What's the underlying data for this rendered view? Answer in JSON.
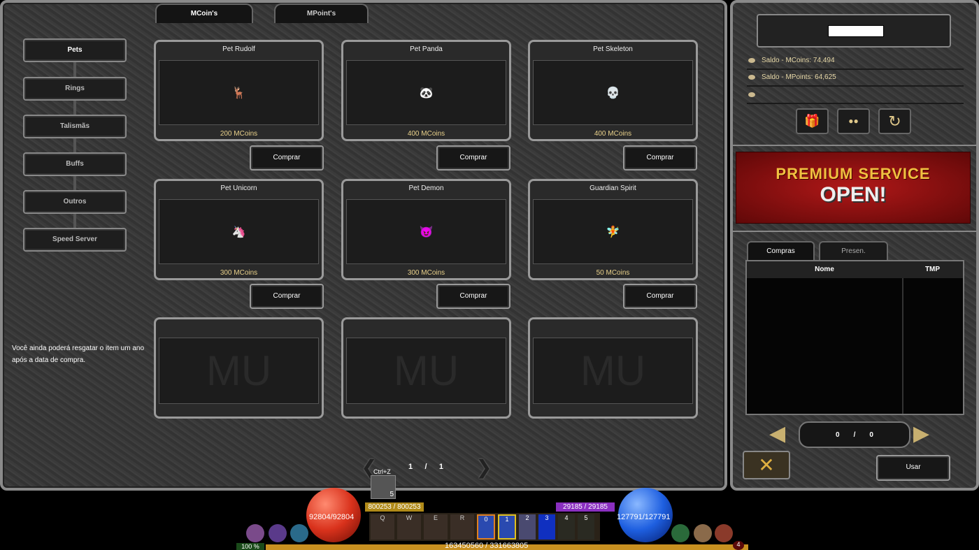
{
  "tabs": [
    {
      "label": "MCoin's",
      "active": true
    },
    {
      "label": "MPoint's",
      "active": false
    }
  ],
  "categories": [
    {
      "label": "Pets",
      "active": true
    },
    {
      "label": "Rings"
    },
    {
      "label": "Talismãs"
    },
    {
      "label": "Buffs"
    },
    {
      "label": "Outros"
    },
    {
      "label": "Speed Server"
    }
  ],
  "notice": "Você ainda poderá resgatar o item um ano após a data de compra.",
  "items": [
    {
      "name": "Pet Rudolf",
      "price": "200 MCoins",
      "buy": "Comprar",
      "icon": "🦌"
    },
    {
      "name": "Pet Panda",
      "price": "400 MCoins",
      "buy": "Comprar",
      "icon": "🐼"
    },
    {
      "name": "Pet Skeleton",
      "price": "400 MCoins",
      "buy": "Comprar",
      "icon": "💀"
    },
    {
      "name": "Pet Unicorn",
      "price": "300 MCoins",
      "buy": "Comprar",
      "icon": "🦄"
    },
    {
      "name": "Pet Demon",
      "price": "300 MCoins",
      "buy": "Comprar",
      "icon": "😈"
    },
    {
      "name": "Guardian Spirit",
      "price": "50 MCoins",
      "buy": "Comprar",
      "icon": "🧚"
    }
  ],
  "empty_slot_logo": "MU",
  "pager": {
    "current": "1",
    "sep": "/",
    "total": "1"
  },
  "account": {
    "saldo_mcoins": "Saldo - MCoins: 74,494",
    "saldo_mpoints": "Saldo - MPoints: 64,625",
    "third": ""
  },
  "icon_buttons": [
    {
      "icon": "gift-icon",
      "glyph": "🎁"
    },
    {
      "icon": "coins-icon",
      "glyph": "●●"
    },
    {
      "icon": "refresh-icon",
      "glyph": "↻"
    }
  ],
  "banner": {
    "line1": "PREMIUM SERVICE",
    "line2": "OPEN!"
  },
  "storage": {
    "tabs": [
      {
        "label": "Compras",
        "active": true
      },
      {
        "label": "Presen."
      }
    ],
    "columns": [
      "Nome",
      "TMP"
    ],
    "pager": {
      "current": "0",
      "sep": "/",
      "total": "0"
    },
    "use": "Usar"
  },
  "hud": {
    "hp": "92804/92804",
    "mp": "127791/127791",
    "ag": "800253 / 800253",
    "sd": "29185 / 29185",
    "exp": "163450560 / 331663805",
    "exp_percent": "100 %",
    "hotkeys": [
      "Q",
      "W",
      "E",
      "R"
    ],
    "slots": [
      "0",
      "1",
      "2",
      "3",
      "4",
      "5"
    ],
    "ctrlz": "Ctrl+Z",
    "pet_count": "5",
    "level_badge": "4",
    "colors": {
      "hp": "#d9321c",
      "mp": "#1e5fe0",
      "ag": "#b08a18",
      "sd": "#8a2fc0"
    }
  }
}
